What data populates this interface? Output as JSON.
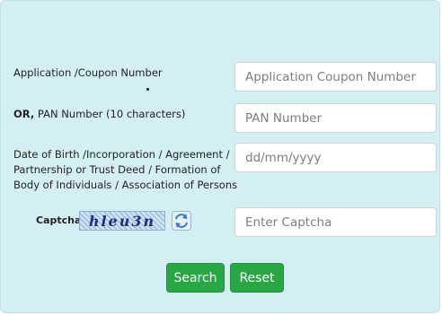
{
  "form": {
    "application_label": "Application /Coupon Number",
    "application_placeholder": "Application Coupon Number",
    "pan_label_prefix": "OR,",
    "pan_label": " PAN Number (10 characters)",
    "pan_placeholder": "PAN Number",
    "dob_label_line1": "Date of Birth /Incorporation / Agreement /",
    "dob_label_line2": "Partnership or Trust Deed / Formation of",
    "dob_label_line3": "Body of Individuals / Association of Persons",
    "dob_placeholder": "dd/mm/yyyy",
    "captcha_label": "Captcha",
    "captcha_text": "hleu3n",
    "captcha_placeholder": "Enter Captcha",
    "refresh_icon": "refresh-icon"
  },
  "buttons": {
    "search_label": "Search",
    "reset_label": "Reset"
  },
  "colors": {
    "panel_bg": "#d4eff3",
    "button_green": "#28a745"
  }
}
